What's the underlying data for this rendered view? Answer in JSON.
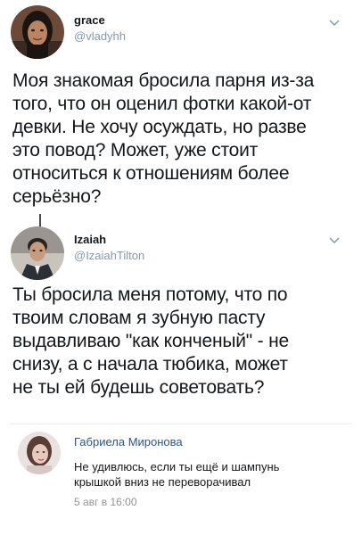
{
  "tweets": [
    {
      "name": "grace",
      "handle": "@vladyhh",
      "avatar_icon": "avatar-woman-dark-hair",
      "menu_icon": "chevron-down-icon",
      "lines": [
        "Моя знакомая бросила парня из-за",
        "того, что он оценил фотки какой-от",
        "девки. Не хочу осуждать, но разве",
        "это повод? Может, уже стоит",
        "относиться к отношениям более",
        "серьёзно?"
      ]
    },
    {
      "name": "Izaiah",
      "handle": "@IzaiahTilton",
      "avatar_icon": "avatar-man-suit",
      "menu_icon": "chevron-down-icon",
      "lines": [
        "Ты бросила меня потому, что по",
        "твоим словам я зубную пасту",
        "выдавливаю \"как конченый\" - не",
        "снизу, а с начала тюбика, может",
        "не ты ей будешь советовать?"
      ]
    }
  ],
  "comment": {
    "name": "Габриела Миронова",
    "avatar_icon": "avatar-woman-light",
    "lines": [
      "Не удивлюсь, если ты ещё и шампунь",
      "крышкой вниз не переворачивал"
    ],
    "date": "5 авг в 16:00"
  },
  "colors": {
    "text": "#14171a",
    "muted": "#8899a6",
    "vk_link": "#2a5885",
    "vk_date": "#939393"
  }
}
